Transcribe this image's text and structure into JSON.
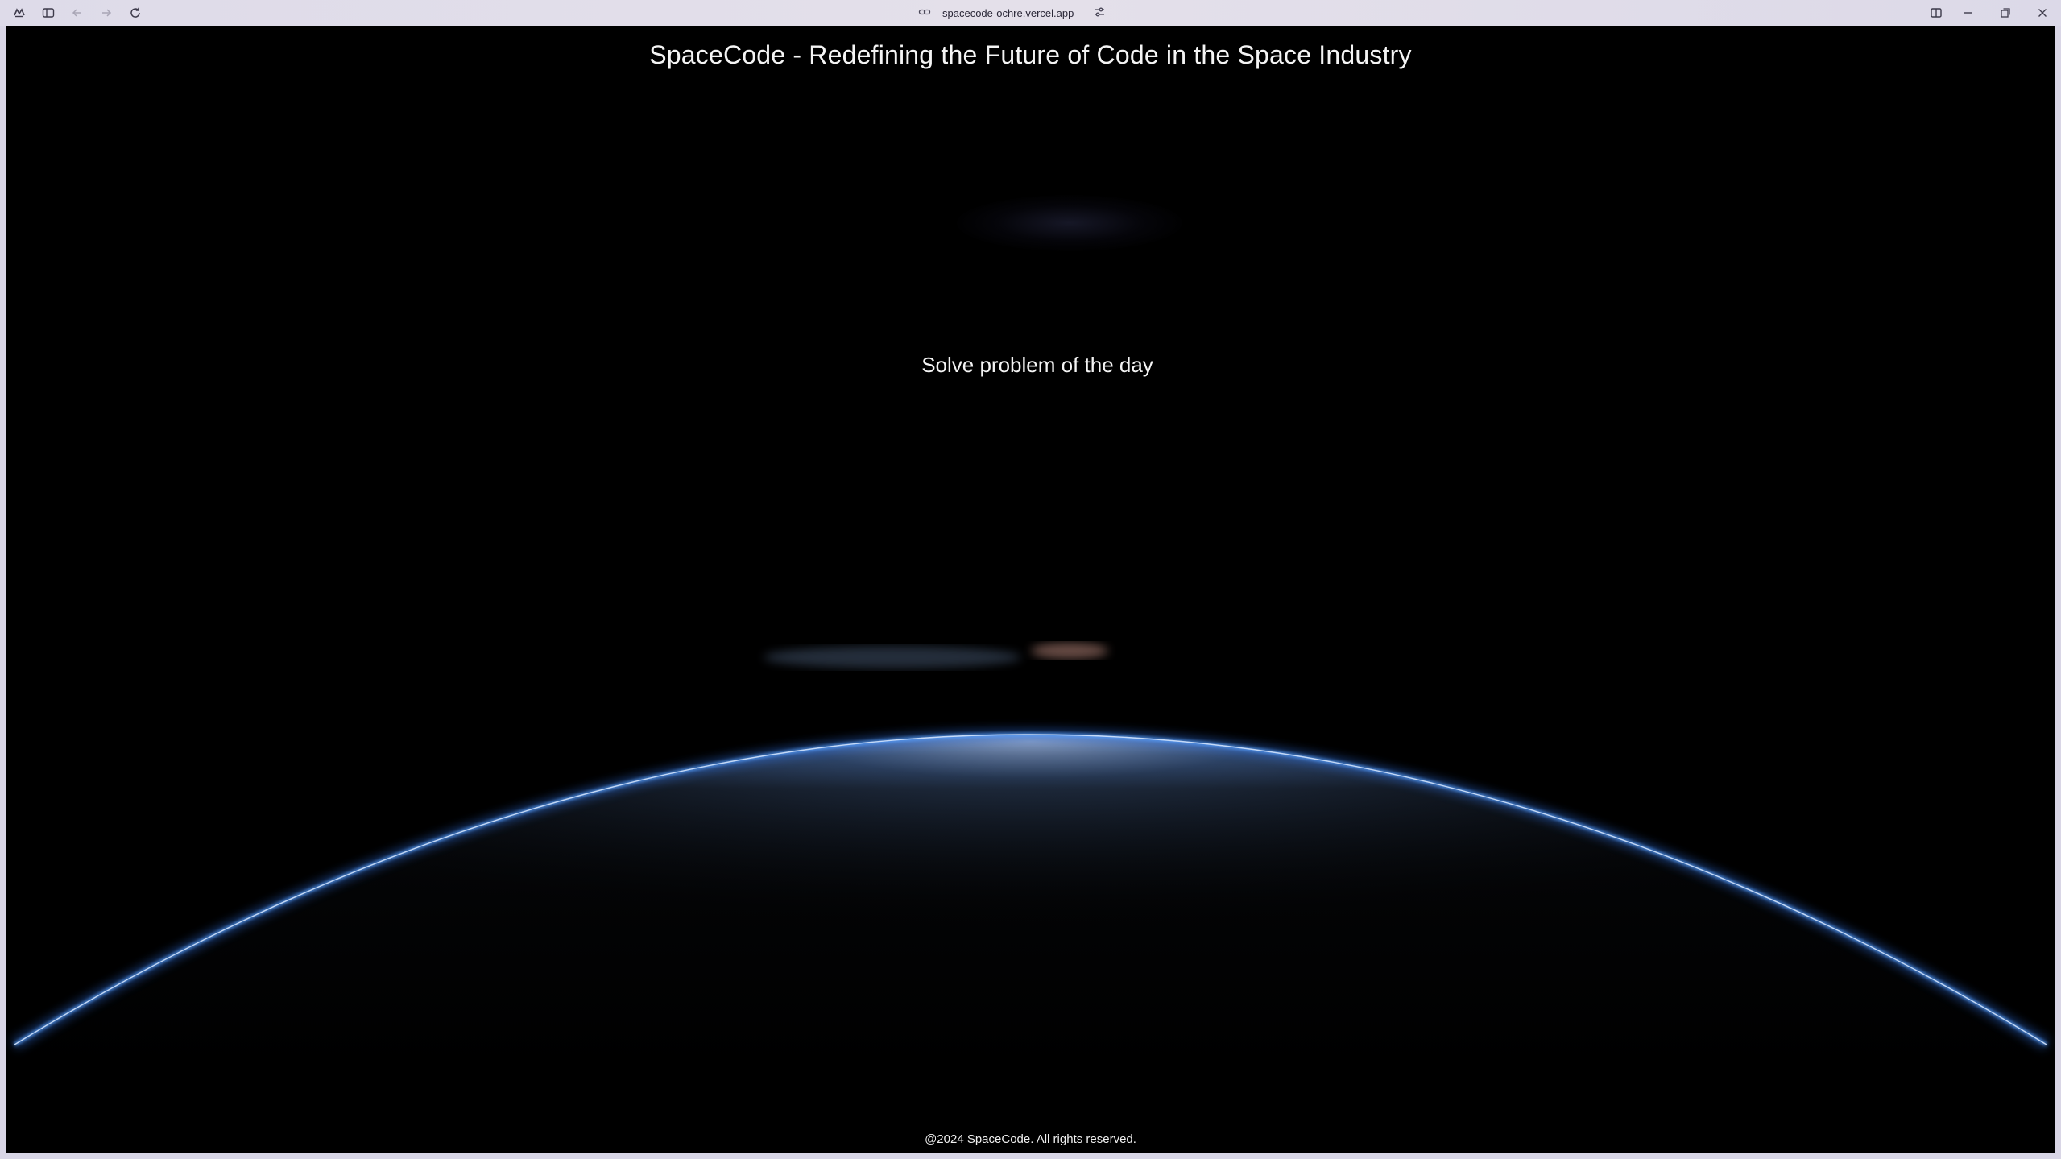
{
  "browser": {
    "url": "spacecode-ochre.vercel.app",
    "icons": {
      "menu": "browser-menu-icon",
      "sidebar": "sidebar-toggle-icon",
      "back": "back-arrow-icon",
      "forward": "forward-arrow-icon",
      "reload": "reload-icon",
      "link": "link-icon",
      "site_settings": "site-settings-icon",
      "split_view": "split-view-icon",
      "minimize": "minimize-icon",
      "restore": "restore-icon",
      "close": "close-icon"
    }
  },
  "page": {
    "title": "SpaceCode - Redefining the Future of Code in the Space Industry",
    "cta_label": "Solve problem of the day",
    "footer": "@2024 SpaceCode. All rights reserved."
  },
  "colors": {
    "background": "#000000",
    "text": "#f4f4f4",
    "atmosphere": "#3f8cff"
  }
}
